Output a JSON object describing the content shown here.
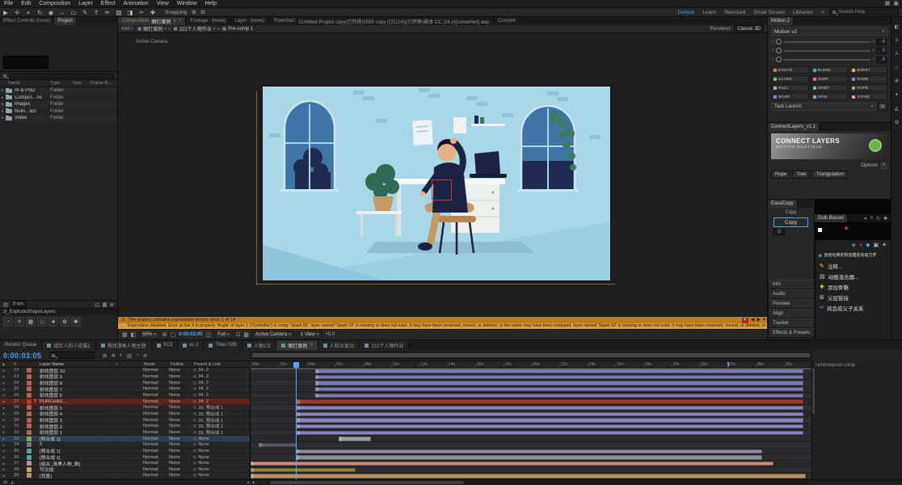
{
  "menubar": {
    "items": [
      "File",
      "Edit",
      "Composition",
      "Layer",
      "Effect",
      "Animation",
      "View",
      "Window",
      "Help"
    ],
    "window_icons": [
      {
        "glyph": "▦",
        "name": "workspace-switch-icon"
      },
      {
        "glyph": "▣",
        "name": "maximize-icon"
      }
    ]
  },
  "toolbar": {
    "tools": [
      {
        "glyph": "▶",
        "name": "selection-tool"
      },
      {
        "glyph": "✛",
        "name": "hand-tool"
      },
      {
        "glyph": "⌖",
        "name": "zoom-tool"
      },
      {
        "glyph": "↻",
        "name": "rotation-tool"
      },
      {
        "glyph": "◉",
        "name": "unified-camera-tool"
      },
      {
        "glyph": "↔",
        "name": "pan-behind-tool"
      },
      {
        "glyph": "▭",
        "name": "rectangle-tool"
      },
      {
        "glyph": "✎",
        "name": "pen-tool"
      },
      {
        "glyph": "T",
        "name": "type-tool"
      },
      {
        "glyph": "✏",
        "name": "brush-tool"
      },
      {
        "glyph": "▧",
        "name": "clone-stamp-tool"
      },
      {
        "glyph": "◨",
        "name": "eraser-tool"
      },
      {
        "glyph": "✂",
        "name": "roto-brush-tool"
      },
      {
        "glyph": "✚",
        "name": "puppet-pin-tool"
      }
    ],
    "snapping": "Snapping",
    "snap_icons": [
      {
        "glyph": "⊞",
        "name": "snap-option-icon"
      },
      {
        "glyph": "⊟",
        "name": "snap-mask-icon"
      }
    ],
    "workspaces": [
      "Default",
      "Learn",
      "Standard",
      "Small Screen",
      "Libraries"
    ],
    "overflow_glyph": "»",
    "search_placeholder": "Search Help"
  },
  "project": {
    "tabs": [
      "Effect Controls (none)",
      "Project"
    ],
    "columns": [
      "Name",
      "Type",
      "Size",
      "Frame R..."
    ],
    "items": [
      {
        "name": "AI & PSD",
        "type": "Folder"
      },
      {
        "name": "Compos...ns",
        "type": "Folder"
      },
      {
        "name": "Images",
        "type": "Folder"
      },
      {
        "name": "Nulls...lids",
        "type": "Folder"
      },
      {
        "name": "Video",
        "type": "Folder"
      }
    ],
    "depth": "8 bpc",
    "footer_icons": [
      {
        "glyph": "▤",
        "name": "interpret-footage-icon"
      }
    ],
    "footer_icons_right": [
      {
        "glyph": "◱",
        "name": "new-folder-icon"
      },
      {
        "glyph": "▦",
        "name": "new-composition-icon"
      },
      {
        "glyph": "⊗",
        "name": "delete-icon"
      }
    ],
    "script_tab": "zl_ExplodeShapeLayers",
    "script_icons": [
      {
        "glyph": "◔",
        "name": "explode-icon"
      },
      {
        "glyph": "✛",
        "name": "anchor-icon"
      },
      {
        "glyph": "▦",
        "name": "grid-icon"
      },
      {
        "glyph": "◇",
        "name": "mask-icon"
      },
      {
        "glyph": "★",
        "name": "star-icon"
      },
      {
        "glyph": "✿",
        "name": "flower-icon"
      },
      {
        "glyph": "✱",
        "name": "settings-icon"
      }
    ]
  },
  "viewer": {
    "tabs": [
      {
        "label": "Composition",
        "name": "图钉案例",
        "active": true
      },
      {
        "label": "Footage:",
        "name": "(none)",
        "active": false
      },
      {
        "label": "Layer:",
        "name": "(none)",
        "active": false
      },
      {
        "label": "Flowchart:",
        "name": "1Untitled Project copy(已转换)5555 copy (CC(14))(已转换)副本 CC (24.x)[converted].aep",
        "active": false
      },
      {
        "label": "Console",
        "name": "",
        "active": false
      }
    ],
    "breadcrumb": [
      "图钉案例",
      "222个人物作业",
      "Pre-comp 1"
    ],
    "add_label": "Add I",
    "renderer_label": "Renderer:",
    "renderer_value": "Classic 3D",
    "view_label": "Active Camera",
    "footer": {
      "items": [
        {
          "t": "icon",
          "glyph": "▦",
          "name": "snapshot-icon"
        },
        {
          "t": "icon",
          "glyph": "◧",
          "name": "show-channel-icon"
        },
        {
          "t": "select",
          "label": "50%",
          "name": "magnification-select"
        },
        {
          "t": "icon",
          "glyph": "⊞",
          "name": "grid-guides-icon"
        },
        {
          "t": "icon",
          "glyph": "▢",
          "name": "mask-visibility-icon"
        },
        {
          "t": "time",
          "label": "0:00:03:05",
          "name": "preview-time"
        },
        {
          "t": "icon",
          "glyph": "◫",
          "name": "show-snapshot-icon"
        },
        {
          "t": "select",
          "label": "Full",
          "name": "resolution-select"
        },
        {
          "t": "icon",
          "glyph": "⊡",
          "name": "region-of-interest-icon"
        },
        {
          "t": "icon",
          "glyph": "▩",
          "name": "transparency-grid-icon"
        },
        {
          "t": "select",
          "label": "Active Camera",
          "name": "3d-view-select"
        },
        {
          "t": "select",
          "label": "1 View",
          "name": "view-layout-select"
        },
        {
          "t": "text",
          "label": "+5.0",
          "name": "exposure-value"
        }
      ]
    }
  },
  "banner": {
    "warn_glyph": "⚠",
    "line1": "The project contains expression errors: error 1 of 14",
    "line2": "Expression disabled. Error at line 3 in property 'Angle' of layer 1 ('Controller') in comp 'Spark 02'. layer named 'Spark 02' is missing or does not exist. It may have been renamed, moved, or deleted, or the name may have been mistyped. layer named 'Spark 02' is missing or does not exist. It may have been renamed, moved, or deleted, or the name may have been mistyped. A property expression tha",
    "icons": [
      {
        "glyph": "×",
        "name": "banner-close-icon"
      },
      {
        "glyph": "◀",
        "name": "banner-prev-icon"
      },
      {
        "glyph": "▶",
        "name": "banner-next-icon"
      },
      {
        "glyph": "▾",
        "name": "banner-expand-icon"
      }
    ]
  },
  "motion": {
    "tab": "Motion 2",
    "version": "Motion v2",
    "param_values": [
      "0",
      "0",
      "0"
    ],
    "buttons": [
      {
        "label": "EXCITE",
        "color": "#e2814d"
      },
      {
        "label": "BLEND",
        "color": "#5aa0d8"
      },
      {
        "label": "BURST",
        "color": "#e2b34d"
      },
      {
        "label": "CLONE",
        "color": "#7dc47d"
      },
      {
        "label": "JUMP",
        "color": "#d87a7a"
      },
      {
        "label": "NAME",
        "color": "#8a8ad8"
      },
      {
        "label": "NULL",
        "color": "#b0b0b0"
      },
      {
        "label": "ORBIT",
        "color": "#5ac4c4"
      },
      {
        "label": "ROPE",
        "color": "#c49a6a"
      },
      {
        "label": "WARP",
        "color": "#b07ad8"
      },
      {
        "label": "SPIN",
        "color": "#7ab0d8"
      },
      {
        "label": "STARE",
        "color": "#d8a0b0"
      }
    ],
    "task_launch": "Task Launch"
  },
  "connect_layers": {
    "tab": "ConnectLayers_v1.1",
    "logo_line1": "CONNECT LAYERS",
    "logo_line2": "MOTION BOUTIQUE",
    "options": "Options",
    "help": "?",
    "buttons": [
      "Rope",
      "Tree",
      "Triangulation"
    ]
  },
  "ease_copy": {
    "tab": "EaseCopy",
    "title": "Copy",
    "button": "Copy",
    "value": "0"
  },
  "duik": {
    "tab": "Duik Bassel",
    "icons": [
      {
        "glyph": "▾",
        "name": "chevron-down-icon"
      },
      {
        "glyph": "≡",
        "name": "menu-icon"
      },
      {
        "glyph": "↻",
        "name": "refresh-icon"
      },
      {
        "glyph": "✱",
        "name": "settings-icon"
      }
    ]
  },
  "duik_cn": {
    "header_icons": [
      {
        "glyph": "◈",
        "color": "#4ba0e8",
        "name": "rig-icon"
      },
      {
        "glyph": "●",
        "color": "#c5281e",
        "name": "record-icon"
      },
      {
        "glyph": "◆",
        "color": "#4ba0e8",
        "name": "link-icon"
      },
      {
        "glyph": "▣",
        "color": "#b5b5b5",
        "name": "structure-icon"
      },
      {
        "glyph": "✦",
        "color": "#e8c547",
        "name": "star-icon"
      }
    ],
    "highlight": {
      "glyph": "◈",
      "color": "#4ba0e8",
      "label": "自动化绑定和创建反向动力学"
    },
    "items": [
      {
        "glyph": "✎",
        "color": "#e8c547",
        "label": "注释..."
      },
      {
        "glyph": "▤",
        "color": "#cccccc",
        "label": "动画混合器..."
      },
      {
        "glyph": "✚",
        "color": "#e8c547",
        "label": "添加骨骼"
      },
      {
        "glyph": "⊞",
        "color": "#cccccc",
        "label": "父层链接"
      },
      {
        "glyph": "∞",
        "color": "#4ba0e8",
        "label": "将会成父子关系"
      }
    ]
  },
  "side_tabs": [
    "Info",
    "Audio",
    "Preview",
    "Align",
    "Tracker",
    "Effects & Presets"
  ],
  "right_footer": "rainbowprod.comp",
  "edge_icons": [
    {
      "glyph": "◧",
      "name": "collapse-panel-icon"
    },
    {
      "glyph": "✛",
      "name": "anchor-icon"
    },
    {
      "glyph": "A",
      "name": "character-panel-icon"
    },
    {
      "glyph": "◇",
      "name": "mask-icon"
    },
    {
      "glyph": "❖",
      "name": "effects-icon"
    },
    {
      "glyph": "✦",
      "name": "presets-icon"
    },
    {
      "glyph": "◭",
      "name": "audio-panel-icon"
    },
    {
      "glyph": "✿",
      "name": "brushes-icon"
    }
  ],
  "bottom_tabs": [
    {
      "label": "Render Queue",
      "icon": false,
      "active": false
    },
    {
      "label": "绿巨人的小花猫1",
      "icon": true,
      "active": false
    },
    {
      "label": "橙改清晰人物主题",
      "icon": true,
      "active": false
    },
    {
      "label": "SC3",
      "icon": true,
      "active": false
    },
    {
      "label": "sc 2",
      "icon": true,
      "active": false
    },
    {
      "label": "Titles 02B",
      "icon": true,
      "active": false
    },
    {
      "label": "人物2次",
      "icon": true,
      "active": false
    },
    {
      "label": "图钉案例",
      "icon": true,
      "active": true
    },
    {
      "label": "人和沙发31",
      "icon": true,
      "active": false
    },
    {
      "label": "222个人物作业",
      "icon": true,
      "active": false
    }
  ],
  "timeline": {
    "time": "0:00:03:05",
    "header_icons": [
      {
        "glyph": "⊞",
        "name": "comp-mini-flowchart-icon"
      },
      {
        "glyph": "❄",
        "name": "draft-3d-icon"
      },
      {
        "glyph": "◐",
        "name": "hide-shy-icon"
      },
      {
        "glyph": "▥",
        "name": "frame-blending-icon"
      },
      {
        "glyph": "◔",
        "name": "motion-blur-icon"
      },
      {
        "glyph": "≋",
        "name": "graph-editor-icon"
      }
    ],
    "columns": {
      "num": "#",
      "name": "Layer Name",
      "mode": "Mode",
      "trkmat": "TrkMat",
      "parent": "Parent & Link"
    },
    "ruler": [
      "00s",
      "02s",
      "04s",
      "06s",
      "08s",
      "10s",
      "12s",
      "14s",
      "16s",
      "18s",
      "20s",
      "22s",
      "24s",
      "26s",
      "28s",
      "30s",
      "32s",
      "34s",
      "36s",
      "38s"
    ],
    "cti_seconds": 3.2,
    "marker_seconds": 34,
    "layers": [
      {
        "num": "22",
        "name": "射线图层 10",
        "chip": "#c25b4f",
        "mode": "Normal",
        "trkmat": "None",
        "parent": "34. 2",
        "bar": {
          "s": 4.6,
          "e": 39.4,
          "c": "#7b7bae"
        }
      },
      {
        "num": "23",
        "name": "射线图层 9",
        "chip": "#c25b4f",
        "mode": "Normal",
        "trkmat": "None",
        "parent": "34. 2",
        "bar": {
          "s": 4.6,
          "e": 39.4,
          "c": "#7b7bae"
        }
      },
      {
        "num": "24",
        "name": "射线图层 8",
        "chip": "#c25b4f",
        "mode": "Normal",
        "trkmat": "None",
        "parent": "34. 2",
        "bar": {
          "s": 4.6,
          "e": 39.4,
          "c": "#7b7bae"
        }
      },
      {
        "num": "25",
        "name": "射线图层 7",
        "chip": "#c25b4f",
        "mode": "Normal",
        "trkmat": "None",
        "parent": "34. 2",
        "bar": {
          "s": 4.6,
          "e": 39.4,
          "c": "#7b7bae"
        }
      },
      {
        "num": "26",
        "name": "射线图层 6",
        "chip": "#c25b4f",
        "mode": "Normal",
        "trkmat": "None",
        "parent": "34. 2",
        "bar": {
          "s": 4.6,
          "e": 39.4,
          "c": "#7b7bae"
        }
      },
      {
        "num": "27",
        "name": "PURCHAS...",
        "pre": "T",
        "sel": "red",
        "chip": "#c2372b",
        "mode": "Normal",
        "trkmat": "None",
        "parent": "34. 2",
        "bar": {
          "s": 3.3,
          "e": 39.4,
          "c": "#9e3c30"
        }
      },
      {
        "num": "28",
        "name": "射线图层 5",
        "chip": "#c25b4f",
        "mode": "Normal",
        "trkmat": "None",
        "parent": "35. 预合成 1",
        "bar": {
          "s": 3.3,
          "e": 39.4,
          "c": "#8b84b8"
        }
      },
      {
        "num": "29",
        "name": "射线图层 4",
        "chip": "#c25b4f",
        "mode": "Normal",
        "trkmat": "None",
        "parent": "35. 预合成 1",
        "bar": {
          "s": 3.3,
          "e": 39.4,
          "c": "#8b84b8"
        }
      },
      {
        "num": "30",
        "name": "射线图层 3",
        "chip": "#c25b4f",
        "mode": "Normal",
        "trkmat": "None",
        "parent": "35. 预合成 1",
        "bar": {
          "s": 3.3,
          "e": 39.4,
          "c": "#8b84b8"
        }
      },
      {
        "num": "31",
        "name": "射线图层 2",
        "chip": "#c25b4f",
        "mode": "Normal",
        "trkmat": "None",
        "parent": "35. 预合成 1",
        "bar": {
          "s": 3.3,
          "e": 39.4,
          "c": "#8b84b8"
        }
      },
      {
        "num": "32",
        "name": "射线图层 1",
        "chip": "#c25b4f",
        "mode": "Normal",
        "trkmat": "None",
        "parent": "35. 预合成 1",
        "bar": {
          "s": 3.3,
          "e": 39.4,
          "c": "#8b84b8"
        }
      },
      {
        "num": "33",
        "name": "[预合成 1]",
        "sel": "blue",
        "chip": "#8aa84a",
        "mode": "Normal",
        "trkmat": "None",
        "parent": "None",
        "bar": {
          "s": 6.3,
          "e": 8.6,
          "c": "#9a9aa4"
        }
      },
      {
        "num": "34",
        "name": "2",
        "chip": "#777777",
        "mode": "Normal",
        "trkmat": "None",
        "parent": "None",
        "bar": {
          "s": 0.6,
          "e": 3.3,
          "c": "#5a5a64"
        }
      },
      {
        "num": "35",
        "name": "[预合成 1]",
        "chip": "#4aa8a0",
        "mode": "Normal",
        "trkmat": "None",
        "parent": "None",
        "bar": {
          "s": 3.2,
          "e": 36.5,
          "c": "#8f8f9b"
        }
      },
      {
        "num": "36",
        "name": "[预合成 1]",
        "chip": "#4aa8a0",
        "mode": "Normal",
        "trkmat": "None",
        "parent": "None",
        "bar": {
          "s": 3.2,
          "e": 36.5,
          "c": "#8f8f9b"
        }
      },
      {
        "num": "37",
        "name": "[组合_清黑人物_数]",
        "chip": "#d084a0",
        "mode": "Normal",
        "trkmat": "None",
        "parent": "None",
        "bar": {
          "s": 0,
          "e": 37.3,
          "c": "#cd8b80"
        }
      },
      {
        "num": "38",
        "name": "可交插",
        "chip": "#c8b040",
        "mode": "Normal",
        "trkmat": "None",
        "parent": "None",
        "bar": {
          "s": 0,
          "e": 7.5,
          "c": "#94823a"
        }
      },
      {
        "num": "39",
        "name": "[背景]",
        "chip": "#b09568",
        "mode": "Normal",
        "trkmat": "None",
        "parent": "None",
        "bar": {
          "s": 0,
          "e": 39.6,
          "c": "#b29266"
        }
      }
    ],
    "bottom_icons": [
      {
        "glyph": "▤",
        "name": "expand-layers-icon"
      },
      {
        "glyph": "◭",
        "name": "audio-toggle-icon"
      }
    ],
    "zoom_icons": [
      {
        "glyph": "▴",
        "name": "zoom-out-mountain-icon"
      },
      {
        "glyph": "▲",
        "name": "zoom-in-mountain-icon"
      }
    ]
  }
}
